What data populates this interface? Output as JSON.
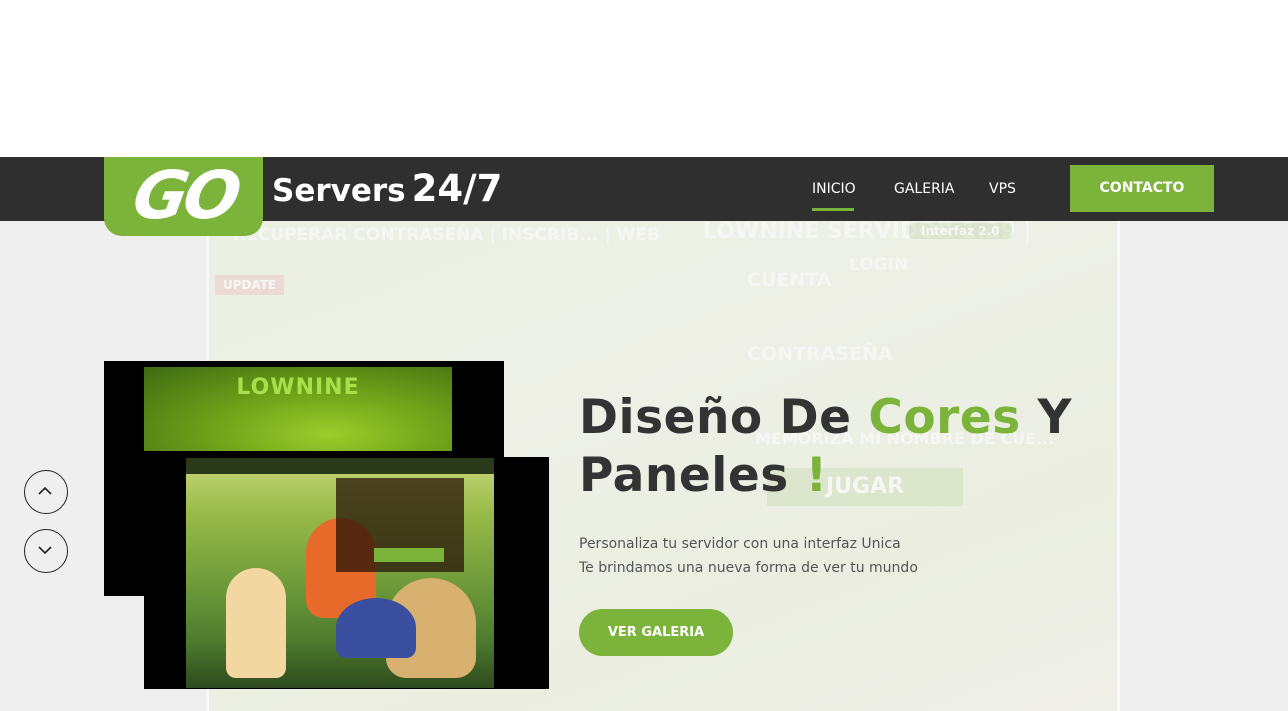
{
  "brand": {
    "logo_text": "GO",
    "name": "Servers",
    "hours": "24/7"
  },
  "nav": {
    "items": [
      {
        "label": "INICIO",
        "active": true
      },
      {
        "label": "GALERIA",
        "active": false
      },
      {
        "label": "VPS",
        "active": false
      }
    ],
    "contact_label": "CONTACTO"
  },
  "hero": {
    "headline_part1": "Diseño De",
    "headline_green": "Cores",
    "headline_part2": "Y",
    "headline_part3": "Paneles",
    "headline_exclaim": "!",
    "subtext_line1": "Personaliza tu servidor con una interfaz Unica",
    "subtext_line2": "Te brindamos una nueva forma de ver tu mundo",
    "cta_label": "VER GALERIA",
    "bg_texts": {
      "recover": "RECUPERAR CONTRASEÑA | INSCRIB... | WEB",
      "server": "LOWNINE SERVIDOR 1.29 |",
      "interfaz": "Interfaz 2.0",
      "login": "LOGIN",
      "cuenta": "CUENTA",
      "contrasena": "CONTRASEÑA",
      "memoriza": "MEMORIZA MI NOMBRE DE CUE...",
      "jugar": "JUGAR",
      "update": "UPDATE"
    },
    "screenshot_back_title": "LOWNINE",
    "arrows": [
      "arrow-up-icon",
      "arrow-down-icon"
    ]
  },
  "colors": {
    "accent": "#7bb33b",
    "navbar": "#2f2f2f",
    "headline": "#333333"
  }
}
